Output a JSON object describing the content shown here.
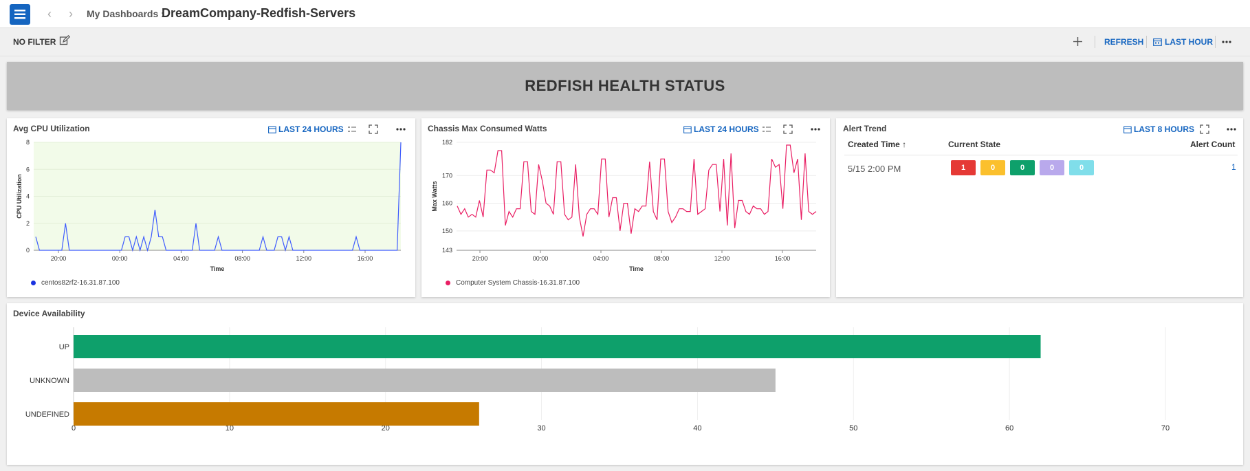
{
  "header": {
    "breadcrumb": "My Dashboards :",
    "title": "DreamCompany-Redfish-Servers"
  },
  "toolbar": {
    "filter_label": "NO FILTER",
    "refresh_label": "REFRESH",
    "range_label": "LAST HOUR"
  },
  "banner": {
    "title": "REDFISH HEALTH STATUS"
  },
  "colors": {
    "primary": "#1565c0",
    "cpu_line": "#3d5afe",
    "watts_line": "#e91e63",
    "up": "#0ea06b",
    "unknown": "#bdbdbd",
    "undefined": "#c67a00"
  },
  "cpu_panel": {
    "title": "Avg CPU Utilization",
    "range": "LAST 24 HOURS",
    "ylabel": "CPU Utilization",
    "xlabel": "Time",
    "legend": "centos82rf2-16.31.87.100",
    "chart_data": {
      "type": "line",
      "x_ticks": [
        "20:00",
        "00:00",
        "04:00",
        "08:00",
        "12:00",
        "16:00"
      ],
      "y_ticks": [
        "0",
        "2",
        "4",
        "6",
        "8"
      ],
      "ylim": [
        0,
        8
      ],
      "series": [
        {
          "name": "centos82rf2-16.31.87.100",
          "values": [
            1,
            0,
            0,
            0,
            0,
            0,
            0,
            0,
            2,
            0,
            0,
            0,
            0,
            0,
            0,
            0,
            0,
            0,
            0,
            0,
            0,
            0,
            0,
            0,
            1,
            1,
            0,
            1,
            0,
            1,
            0,
            1,
            3,
            1,
            1,
            0,
            0,
            0,
            0,
            0,
            0,
            0,
            0,
            2,
            0,
            0,
            0,
            0,
            0,
            1,
            0,
            0,
            0,
            0,
            0,
            0,
            0,
            0,
            0,
            0,
            0,
            1,
            0,
            0,
            0,
            1,
            1,
            0,
            1,
            0,
            0,
            0,
            0,
            0,
            0,
            0,
            0,
            0,
            0,
            0,
            0,
            0,
            0,
            0,
            0,
            0,
            1,
            0,
            0,
            0,
            0,
            0,
            0,
            0,
            0,
            0,
            0,
            0,
            8
          ]
        }
      ]
    }
  },
  "watts_panel": {
    "title": "Chassis Max Consumed Watts",
    "range": "LAST 24 HOURS",
    "ylabel": "Max Watts",
    "xlabel": "Time",
    "legend": "Computer System Chassis-16.31.87.100",
    "chart_data": {
      "type": "line",
      "x_ticks": [
        "20:00",
        "00:00",
        "04:00",
        "08:00",
        "12:00",
        "16:00"
      ],
      "y_ticks": [
        "143",
        "150",
        "160",
        "170",
        "182"
      ],
      "ylim": [
        143,
        182
      ],
      "series": [
        {
          "name": "Computer System Chassis-16.31.87.100",
          "values": [
            159,
            156,
            158,
            155,
            156,
            155,
            161,
            155,
            172,
            172,
            171,
            179,
            179,
            152,
            157,
            155,
            158,
            158,
            175,
            175,
            157,
            156,
            174,
            168,
            160,
            159,
            156,
            175,
            175,
            156,
            154,
            155,
            174,
            155,
            148,
            156,
            158,
            158,
            156,
            176,
            176,
            155,
            162,
            162,
            150,
            160,
            160,
            149,
            158,
            157,
            159,
            159,
            175,
            157,
            154,
            176,
            176,
            157,
            153,
            155,
            158,
            158,
            157,
            157,
            176,
            156,
            157,
            158,
            172,
            174,
            174,
            157,
            176,
            152,
            178,
            151,
            161,
            161,
            157,
            156,
            159,
            158,
            158,
            156,
            157,
            176,
            173,
            174,
            158,
            181,
            181,
            171,
            176,
            154,
            178,
            157,
            156,
            157
          ]
        }
      ]
    }
  },
  "alert_panel": {
    "title": "Alert Trend",
    "range": "LAST 8 HOURS",
    "columns": [
      "Created Time",
      "Current State",
      "Alert Count"
    ],
    "sort_arrow": "↑",
    "rows": [
      {
        "time": "5/15 2:00 PM",
        "states": [
          "1",
          "0",
          "0",
          "0",
          "0"
        ],
        "count": "1"
      }
    ],
    "state_colors": [
      "#e53935",
      "#fbc02d",
      "#0ea06b",
      "#b9a9ec",
      "#80deea"
    ]
  },
  "availability_panel": {
    "title": "Device Availability",
    "chart_data": {
      "type": "bar",
      "orientation": "horizontal",
      "categories": [
        "UP",
        "UNKNOWN",
        "UNDEFINED"
      ],
      "values": [
        62,
        45,
        26
      ],
      "xlim": [
        0,
        70
      ],
      "x_ticks": [
        "0",
        "10",
        "20",
        "30",
        "40",
        "50",
        "60",
        "70"
      ],
      "colors": [
        "#0ea06b",
        "#bdbdbd",
        "#c67a00"
      ]
    }
  }
}
